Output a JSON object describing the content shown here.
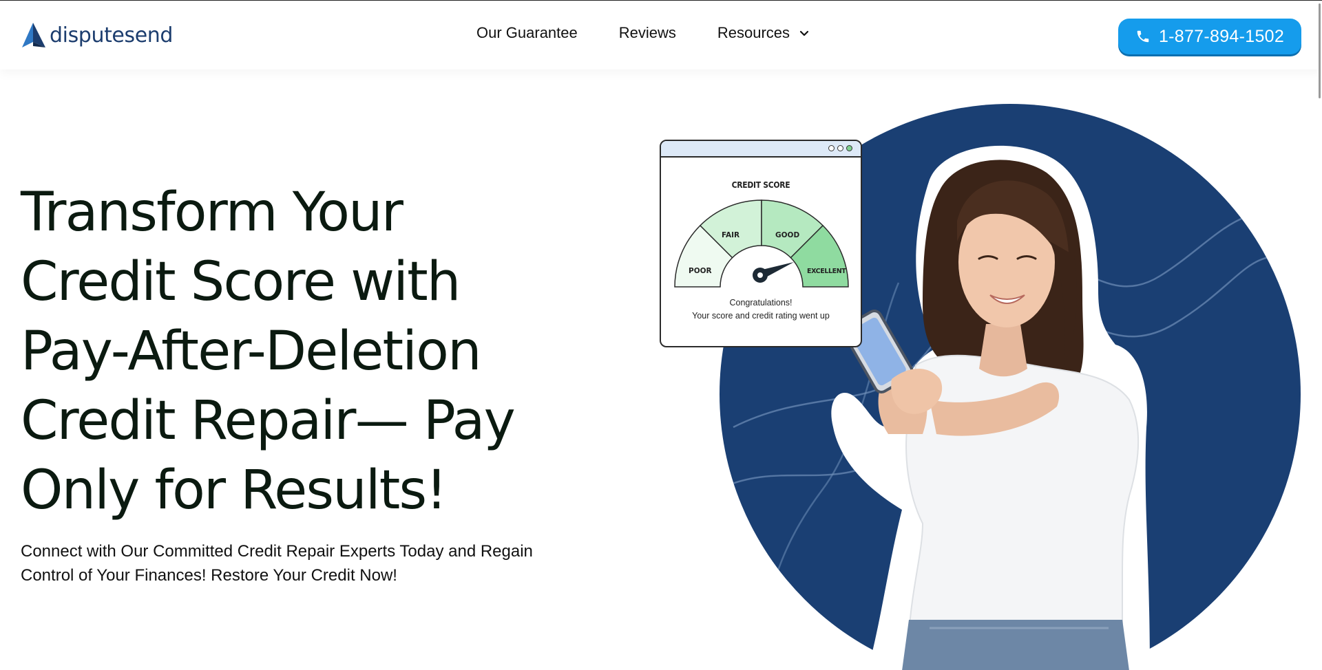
{
  "brand": {
    "name": "disputesend",
    "logo_color": "#1c3d6e"
  },
  "nav": {
    "items": [
      {
        "label": "Our Guarantee"
      },
      {
        "label": "Reviews"
      },
      {
        "label": "Resources"
      }
    ],
    "resources_icon": "chevron-down-icon"
  },
  "cta": {
    "phone": "1-877-894-1502",
    "icon": "phone-icon",
    "color": "#159cec"
  },
  "hero": {
    "title_lines": [
      "Transform Your",
      "Credit Score with",
      "Pay-After-Deletion",
      "Credit Repair— Pay",
      "Only for Results!"
    ],
    "subtitle_lines": [
      "Connect with Our Committed Credit Repair Experts Today and Regain",
      "Control of Your Finances! Restore Your Credit Now!"
    ]
  },
  "score_card": {
    "title": "CREDIT SCORE",
    "segments": [
      "POOR",
      "FAIR",
      "GOOD",
      "EXCELLENT"
    ],
    "message_line1": "Congratulations!",
    "message_line2": "Your score and credit rating went up"
  },
  "colors": {
    "circle": "#1a3f73",
    "title_text": "#0b1a10",
    "gauge_poor": "#effaf1",
    "gauge_fair": "#d2f2d8",
    "gauge_good": "#b5e9c0",
    "gauge_excellent": "#8fdba0"
  }
}
